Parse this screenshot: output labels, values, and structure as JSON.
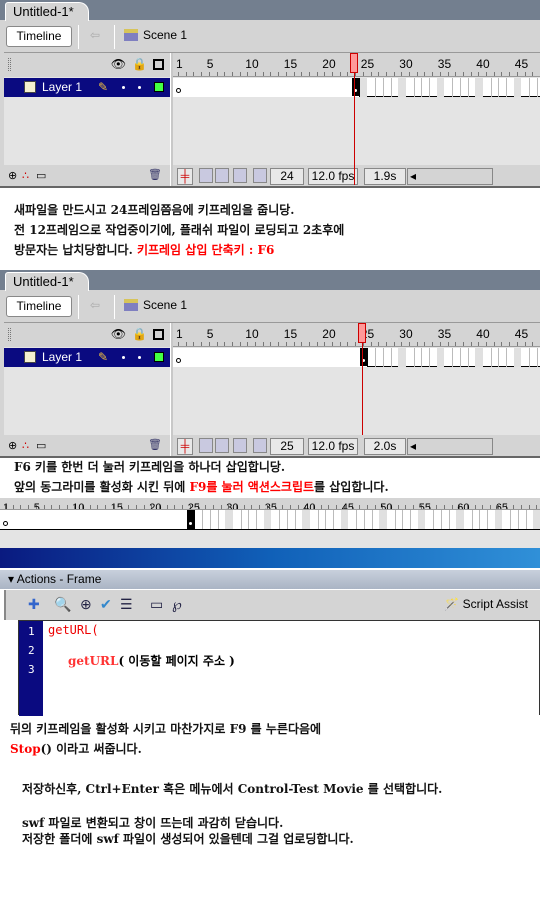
{
  "panel1": {
    "doc_tab": "Untitled-1*",
    "timeline_button": "Timeline",
    "scene": "Scene 1",
    "layer": "Layer 1",
    "current_frame": "24",
    "fps": "12.0 fps",
    "time": "1.9s",
    "ruler_labels": [
      "1",
      "5",
      "10",
      "15",
      "20",
      "25",
      "30",
      "35",
      "40",
      "45"
    ],
    "selected_frame": 24
  },
  "note1": {
    "line1": "새파일을 만드시고 24프레임쯤음에 키프레임을 줍니당.",
    "line2": "전 12프레임으로 작업중이기에, 플래쉬 파일이 로딩되고 2초후에",
    "line3": "방문자는 납치당합니다. ",
    "line3_red": "키프레임 삽입 단축키 : F6"
  },
  "panel2": {
    "doc_tab": "Untitled-1*",
    "timeline_button": "Timeline",
    "scene": "Scene 1",
    "layer": "Layer 1",
    "current_frame": "25",
    "fps": "12.0 fps",
    "time": "2.0s",
    "ruler_labels": [
      "1",
      "5",
      "10",
      "15",
      "20",
      "25",
      "30",
      "35",
      "40",
      "45"
    ],
    "selected_frame": 25
  },
  "note2": {
    "line1": "F6 키를 한번 더 눌러 키프레임을 하나더 삽입합니당.",
    "line2_a": "앞의 동그라미를 활성화 시킨 뒤에 ",
    "line2_red": "F9를 눌러 액션스크립트",
    "line2_b": "를 삽입합니다."
  },
  "strip": {
    "ruler_labels": [
      "1",
      "5",
      "10",
      "15",
      "20",
      "25",
      "30",
      "35",
      "40",
      "45",
      "50",
      "55",
      "60",
      "65"
    ]
  },
  "actions": {
    "title": "Actions - Frame",
    "script_assist": "Script Assist",
    "lines": [
      "1",
      "2",
      "3"
    ],
    "code_line1": "getURL(",
    "code_hint_red": "getURL",
    "code_hint_rest": "( 이동할 페이지 주소 )"
  },
  "note3": {
    "line1": "뒤의 키프레임을 활성화 시키고 마찬가지로 F9 를 누른다음에",
    "line2_red": "Stop",
    "line2_rest": "() 이라고 써줍니다.",
    "line3": "저장하신후, Ctrl+Enter 혹은 메뉴에서 Control-Test Movie 를 선택합니다.",
    "line4": "swf 파일로 변환되고 창이 뜨는데 과감히 닫습니다.",
    "line5": "저장한 폴더에 swf 파일이 생성되어 있을텐데 그걸 업로딩합니다."
  },
  "colors": {
    "layer_selected": "#0a0a80",
    "playhead": "#ff9999",
    "highlight_text": "#ff0000"
  }
}
